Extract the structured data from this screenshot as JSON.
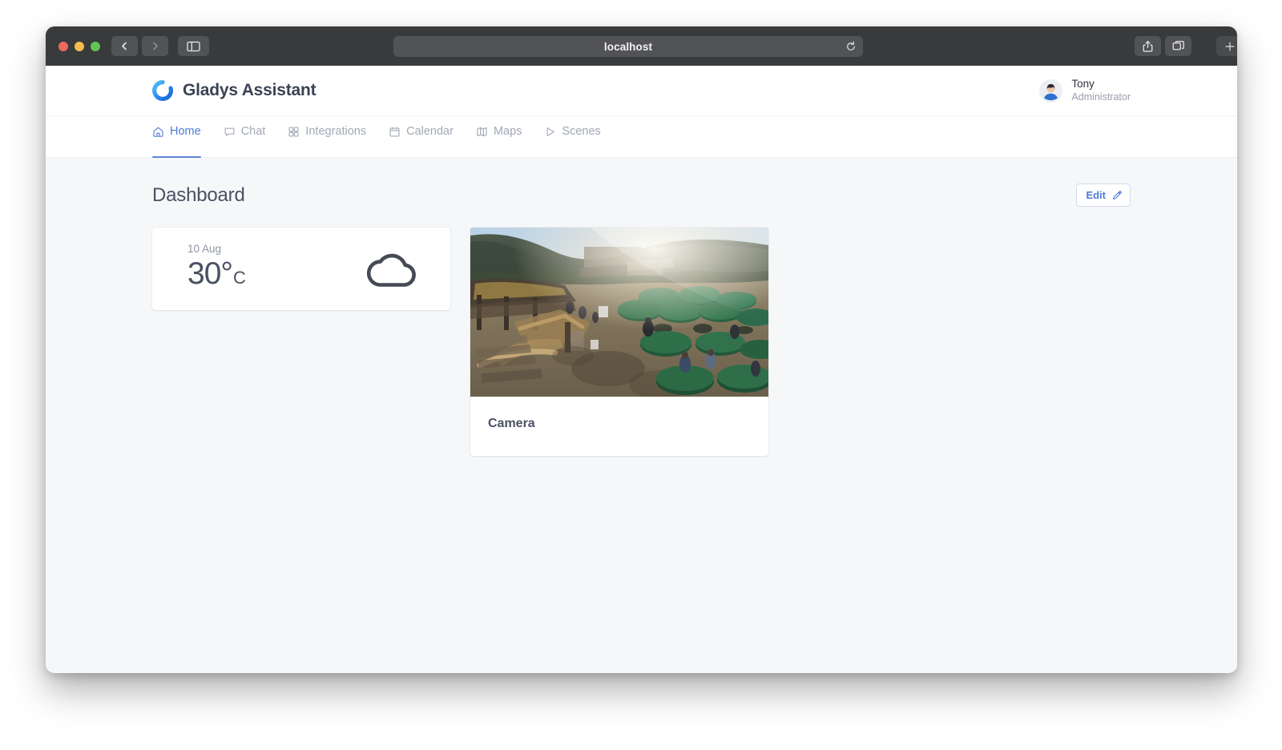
{
  "browser": {
    "address": "localhost",
    "icons": {
      "back": "back-chevron-icon",
      "forward": "forward-chevron-icon",
      "sidebar": "sidebar-toggle-icon",
      "reload": "reload-icon",
      "share": "share-icon",
      "tabs": "tab-overview-icon",
      "new_tab": "plus-icon"
    },
    "traffic_lights": {
      "close": "#ec6a5f",
      "minimize": "#f4bd4f",
      "zoom": "#61c554"
    }
  },
  "app": {
    "brand_name": "Gladys Assistant",
    "brand_logo_icon": "gladys-logo-icon",
    "accent_color": "#4b7bd6",
    "user": {
      "name": "Tony",
      "role": "Administrator",
      "avatar_icon": "user-avatar"
    }
  },
  "nav": {
    "items": [
      {
        "label": "Home",
        "icon": "home-icon",
        "active": true
      },
      {
        "label": "Chat",
        "icon": "chat-bubble-icon",
        "active": false
      },
      {
        "label": "Integrations",
        "icon": "grid-icon",
        "active": false
      },
      {
        "label": "Calendar",
        "icon": "calendar-icon",
        "active": false
      },
      {
        "label": "Maps",
        "icon": "map-icon",
        "active": false
      },
      {
        "label": "Scenes",
        "icon": "play-triangle-icon",
        "active": false
      }
    ]
  },
  "page": {
    "title": "Dashboard",
    "edit_button": {
      "label": "Edit",
      "icon": "edit-pencil-square-icon"
    }
  },
  "cards": {
    "weather": {
      "date": "10 Aug",
      "temperature": "30°",
      "unit": "C",
      "condition_icon": "cloud-icon"
    },
    "camera": {
      "label": "Camera",
      "image_alt": "outdoor-terrace-with-green-umbrellas"
    }
  }
}
